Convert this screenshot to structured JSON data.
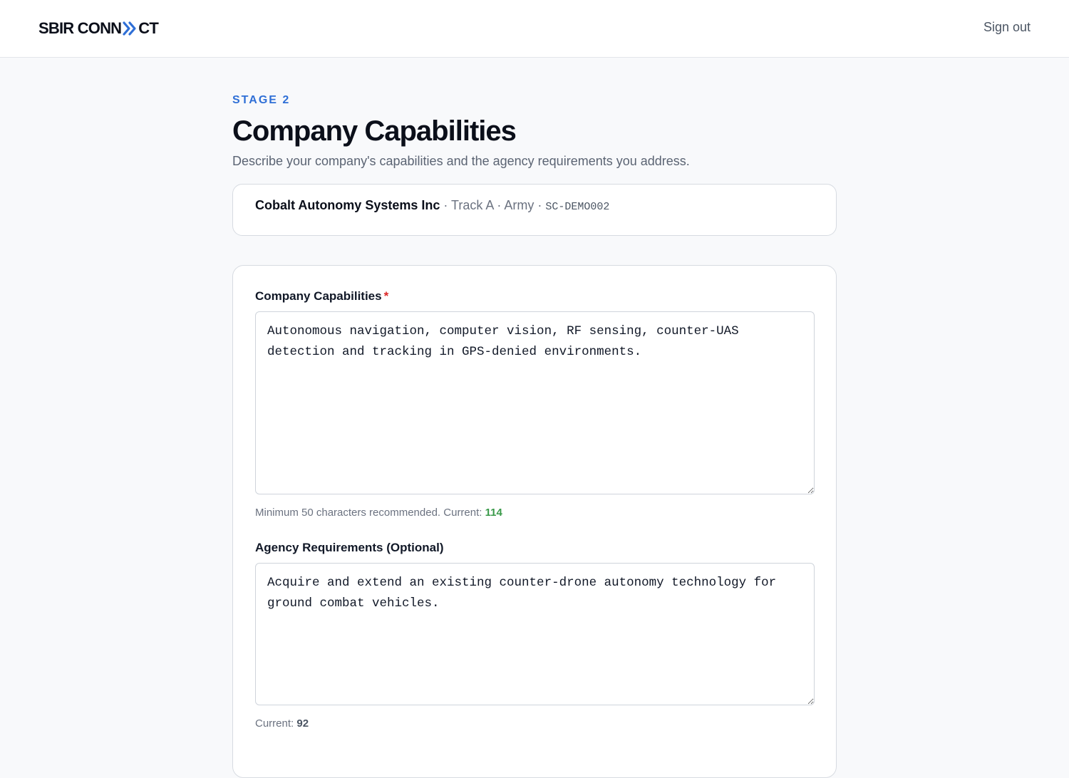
{
  "header": {
    "logo_part1": "SBIR CONN",
    "logo_part2": "CT",
    "logo_icon": "double-chevron-right-icon",
    "sign_out": "Sign out"
  },
  "page": {
    "stage": "STAGE 2",
    "title": "Company Capabilities",
    "subtitle": "Describe your company's capabilities and the agency requirements you address."
  },
  "info": {
    "company": "Cobalt Autonomy Systems Inc",
    "sep": " · ",
    "track": "Track A",
    "agency": "Army",
    "code": "SC-DEMO002"
  },
  "form": {
    "capabilities": {
      "label": "Company Capabilities",
      "required_mark": "*",
      "value": "Autonomous navigation, computer vision, RF sensing, counter-UAS detection and tracking in GPS-denied environments.",
      "hint_prefix": "Minimum 50 characters recommended. Current: ",
      "count": "114"
    },
    "requirements": {
      "label": "Agency Requirements (Optional)",
      "value": "Acquire and extend an existing counter-drone autonomy technology for ground combat vehicles.",
      "hint_prefix": "Current: ",
      "count": "92"
    }
  },
  "colors": {
    "accent_blue": "#2f6fd6",
    "required_red": "#dc2626",
    "count_green": "#3a9a4a"
  }
}
